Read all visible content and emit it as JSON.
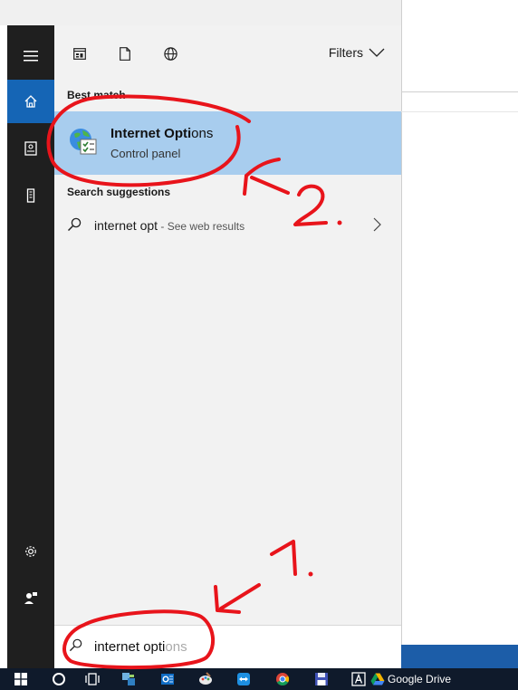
{
  "filters_bar": {
    "filters_label": "Filters"
  },
  "best_match": {
    "heading": "Best match",
    "title_bold": "Internet Opti",
    "title_rest": "ons",
    "subtitle": "Control panel"
  },
  "suggestions": {
    "heading": "Search suggestions",
    "items": [
      {
        "query": "internet opt",
        "hint": " - See web results"
      }
    ]
  },
  "search": {
    "typed": "internet opti",
    "ghost": "ons"
  },
  "taskbar": {
    "drive_label": "Google Drive"
  },
  "annotations": {
    "step1": "1.",
    "step2": "2."
  },
  "colors": {
    "rail": "#1f1f1f",
    "accent": "#1565b5",
    "selection": "#a8cdee",
    "panel": "#f2f2f2",
    "taskbar": "#0f1a2b",
    "annotation": "#e8141b"
  }
}
